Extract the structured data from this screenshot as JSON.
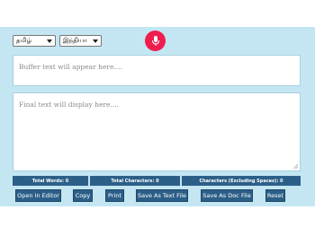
{
  "language_selects": {
    "language": "தமிழ்",
    "region": "இந்தியா"
  },
  "mic": {
    "icon": "microphone-icon",
    "color": "#ee1e4e"
  },
  "buffer_box": {
    "placeholder": "Buffer text will appear here...."
  },
  "final_box": {
    "placeholder": "Final text will display here....",
    "icon": "resize-handle-icon"
  },
  "counts": {
    "words": "Total Words: 0",
    "characters": "Total Characters: 0",
    "characters_no_spaces": "Characters (Excluding Spaces): 0"
  },
  "buttons": {
    "open_in_editor": "Open In Editor",
    "copy": "Copy",
    "print": "Print",
    "save_text": "Save As Text File",
    "save_doc": "Save As Doc File",
    "reset": "Reset"
  },
  "colors": {
    "panel_bg": "#c4e6f3",
    "button_bg": "#2c5f88",
    "accent": "#ee1e4e"
  }
}
